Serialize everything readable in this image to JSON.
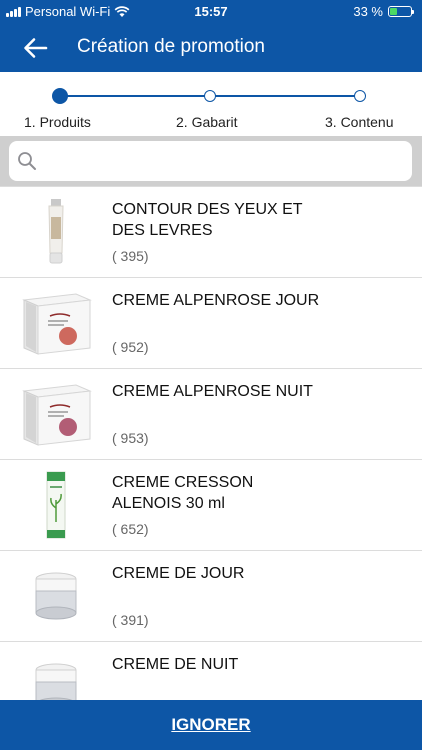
{
  "status_bar": {
    "carrier": "Personal Wi-Fi",
    "time": "15:57",
    "battery_percent": "33 %",
    "battery_level": 0.33,
    "icons": [
      "signal-icon",
      "wifi-icon",
      "battery-icon"
    ]
  },
  "header": {
    "back_icon": "arrow-left-icon",
    "title": "Création de promotion"
  },
  "stepper": {
    "steps": [
      {
        "label": "1. Produits",
        "state": "active"
      },
      {
        "label": "2. Gabarit",
        "state": "inactive"
      },
      {
        "label": "3. Contenu",
        "state": "inactive"
      }
    ]
  },
  "search": {
    "icon": "search-icon",
    "value": "",
    "placeholder": ""
  },
  "products": [
    {
      "name": "CONTOUR DES YEUX ET DES LEVRES",
      "count": "( 395)",
      "thumbnail": "tube"
    },
    {
      "name": "CREME ALPENROSE JOUR",
      "count": "( 952)",
      "thumbnail": "box"
    },
    {
      "name": "CREME ALPENROSE NUIT",
      "count": "( 953)",
      "thumbnail": "box"
    },
    {
      "name": "CREME CRESSON ALENOIS 30 ml",
      "count": "( 652)",
      "thumbnail": "green-tube"
    },
    {
      "name": "CREME DE JOUR",
      "count": "( 391)",
      "thumbnail": "jar"
    },
    {
      "name": "CREME DE NUIT",
      "count": "",
      "thumbnail": "jar"
    }
  ],
  "footer": {
    "ignore_label": "IGNORER"
  },
  "colors": {
    "primary": "#0d56a6",
    "search_band": "#cfcfcf",
    "battery_fill": "#4cd964"
  }
}
